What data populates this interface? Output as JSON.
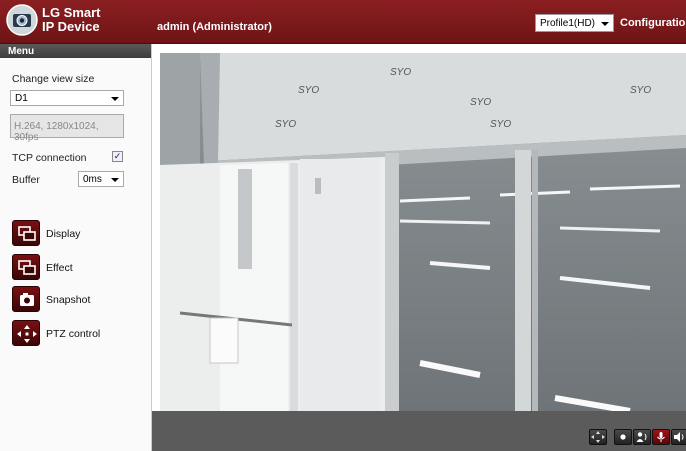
{
  "header": {
    "brand_line1": "LG Smart",
    "brand_line2": "IP Device",
    "user": "admin (Administrator)",
    "profile_value": "Profile1(HD)",
    "configuration": "Configuration"
  },
  "sidebar": {
    "menu_title": "Menu",
    "change_view_label": "Change view size",
    "view_size_value": "D1",
    "stream_info": "H.264, 1280x1024, 30fps",
    "tcp_label": "TCP connection",
    "tcp_check": "✓",
    "buffer_label": "Buffer",
    "buffer_value": "0ms",
    "tools": [
      {
        "label": "Display",
        "icon": "display-icon"
      },
      {
        "label": "Effect",
        "icon": "effect-icon"
      },
      {
        "label": "Snapshot",
        "icon": "camera-icon"
      },
      {
        "label": "PTZ control",
        "icon": "ptz-icon"
      }
    ]
  },
  "video": {
    "sign_text": "SYO"
  },
  "colors": {
    "header": "#7d1a1c",
    "menu_bar": "#4a4a4a",
    "bottom_bar": "#5b5b5b"
  }
}
